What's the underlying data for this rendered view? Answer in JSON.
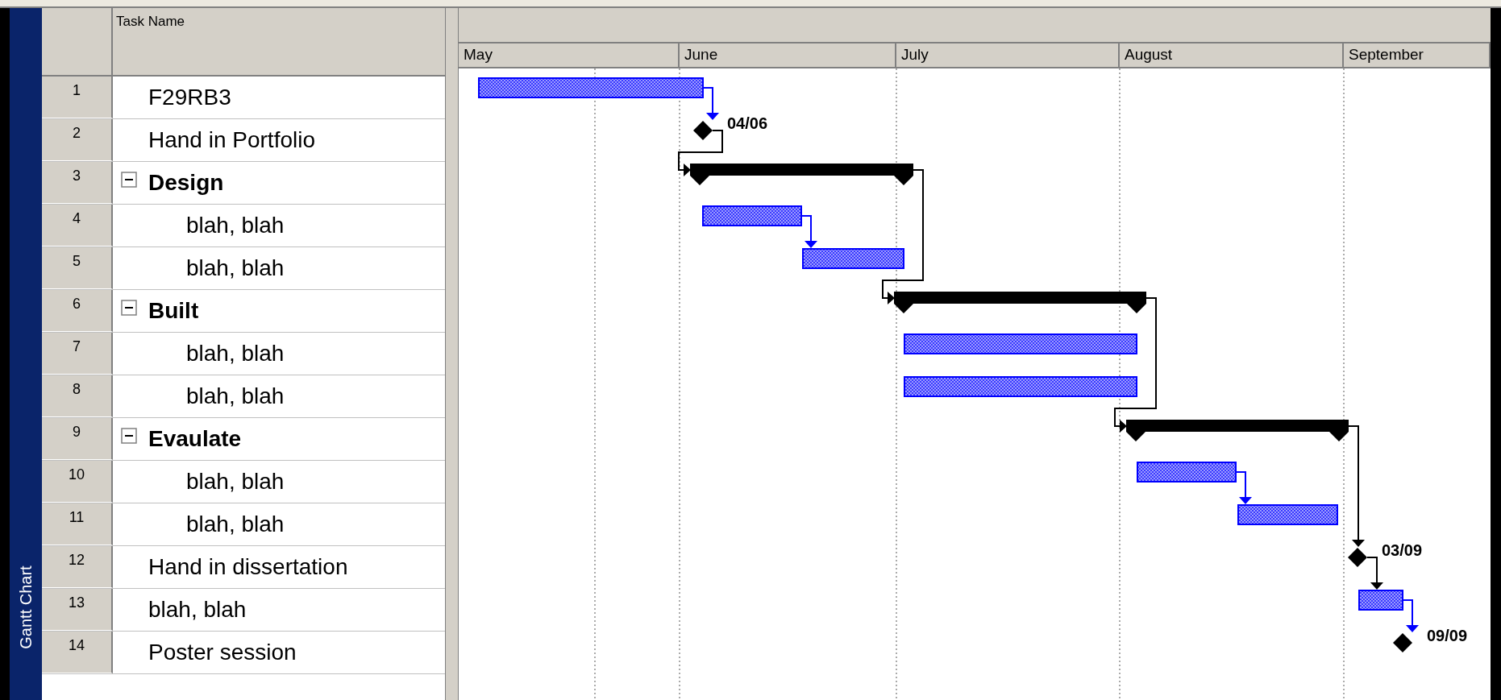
{
  "side_tab": {
    "label": "Gantt Chart"
  },
  "table": {
    "columns": {
      "task_name": "Task Name"
    },
    "rows": [
      {
        "number": "1",
        "name": "F29RB3",
        "kind": "task"
      },
      {
        "number": "2",
        "name": "Hand in Portfolio",
        "kind": "milestone",
        "date_label": "04/06"
      },
      {
        "number": "3",
        "name": "Design",
        "kind": "summary",
        "expanded": true,
        "children": [
          {
            "number": "4",
            "name": "blah, blah",
            "kind": "task"
          },
          {
            "number": "5",
            "name": "blah, blah",
            "kind": "task"
          }
        ]
      },
      {
        "number": "6",
        "name": "Built",
        "kind": "summary",
        "expanded": true,
        "children": [
          {
            "number": "7",
            "name": "blah, blah",
            "kind": "task"
          },
          {
            "number": "8",
            "name": "blah, blah",
            "kind": "task"
          }
        ]
      },
      {
        "number": "9",
        "name": "Evaulate",
        "kind": "summary",
        "expanded": true,
        "children": [
          {
            "number": "10",
            "name": "blah, blah",
            "kind": "task"
          },
          {
            "number": "11",
            "name": "blah, blah",
            "kind": "task"
          }
        ]
      },
      {
        "number": "12",
        "name": "Hand in dissertation",
        "kind": "milestone",
        "date_label": "03/09"
      },
      {
        "number": "13",
        "name": "blah, blah",
        "kind": "task"
      },
      {
        "number": "14",
        "name": "Poster session",
        "kind": "milestone",
        "date_label": "09/09"
      }
    ]
  },
  "timescale": {
    "months": [
      "May",
      "June",
      "July",
      "August",
      "September"
    ]
  }
}
